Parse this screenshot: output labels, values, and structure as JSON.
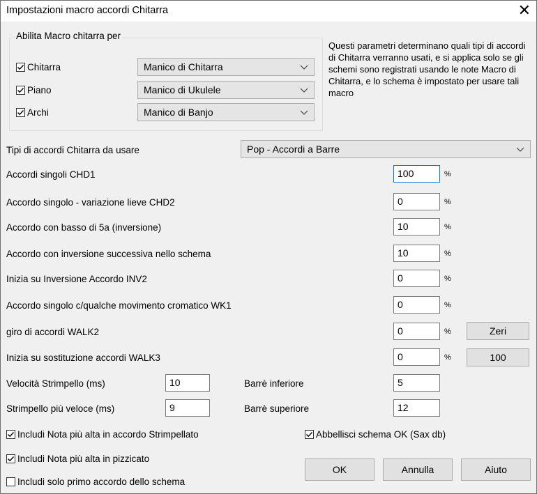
{
  "window": {
    "title": "Impostazioni macro accordi Chitarra"
  },
  "group": {
    "label": "Abilita Macro chitarra per",
    "rows": [
      {
        "label": "Chitarra",
        "checked": true,
        "combo": "Manico di Chitarra"
      },
      {
        "label": "Piano",
        "checked": true,
        "combo": "Manico di Ukulele"
      },
      {
        "label": "Archi",
        "checked": true,
        "combo": "Manico di Banjo"
      }
    ]
  },
  "description": "Questi parametri determinano quali tipi di accordi di Chitarra verranno usati, e si applica solo se gli schemi sono registrati usando le note Macro di Chitarra, e lo schema è impostato per usare tali macro",
  "chord_type": {
    "label": "Tipi di accordi Chitarra da usare",
    "value": "Pop - Accordi a Barre"
  },
  "percent_rows": [
    {
      "label": "Accordi singoli CHD1",
      "value": "100"
    },
    {
      "label": "Accordo singolo - variazione lieve CHD2",
      "value": "0"
    },
    {
      "label": "Accordo con basso di 5a (inversione)",
      "value": "10"
    },
    {
      "label": "Accordo con inversione successiva nello schema",
      "value": "10"
    },
    {
      "label": "Inizia su Inversione Accordo INV2",
      "value": "0"
    },
    {
      "label": "Accordo singolo c/qualche movimento cromatico WK1",
      "value": "0"
    },
    {
      "label": "giro di accordi WALK2",
      "value": "0"
    },
    {
      "label": "Inizia su sostituzione accordi WALK3",
      "value": "0"
    }
  ],
  "percent_symbol": "%",
  "buttons": {
    "zeri": "Zeri",
    "hundred": "100",
    "ok": "OK",
    "cancel": "Annulla",
    "help": "Aiuto"
  },
  "strum": {
    "speed_label": "Velocità Strimpello (ms)",
    "speed_value": "10",
    "faster_label": "Strimpello più veloce (ms)",
    "faster_value": "9",
    "barre_low_label": "Barrè inferiore",
    "barre_low_value": "5",
    "barre_high_label": "Barrè superiore",
    "barre_high_value": "12"
  },
  "checks": {
    "top_note_strum": {
      "label": "Includi Nota più alta in accordo Strimpellato",
      "checked": true
    },
    "embellish": {
      "label": "Abbellisci schema OK (Sax db)",
      "checked": true
    },
    "top_note_pluck": {
      "label": "Includi Nota più alta in pizzicato",
      "checked": true
    },
    "first_only": {
      "label": "Includi solo primo accordo dello schema",
      "checked": false
    }
  }
}
